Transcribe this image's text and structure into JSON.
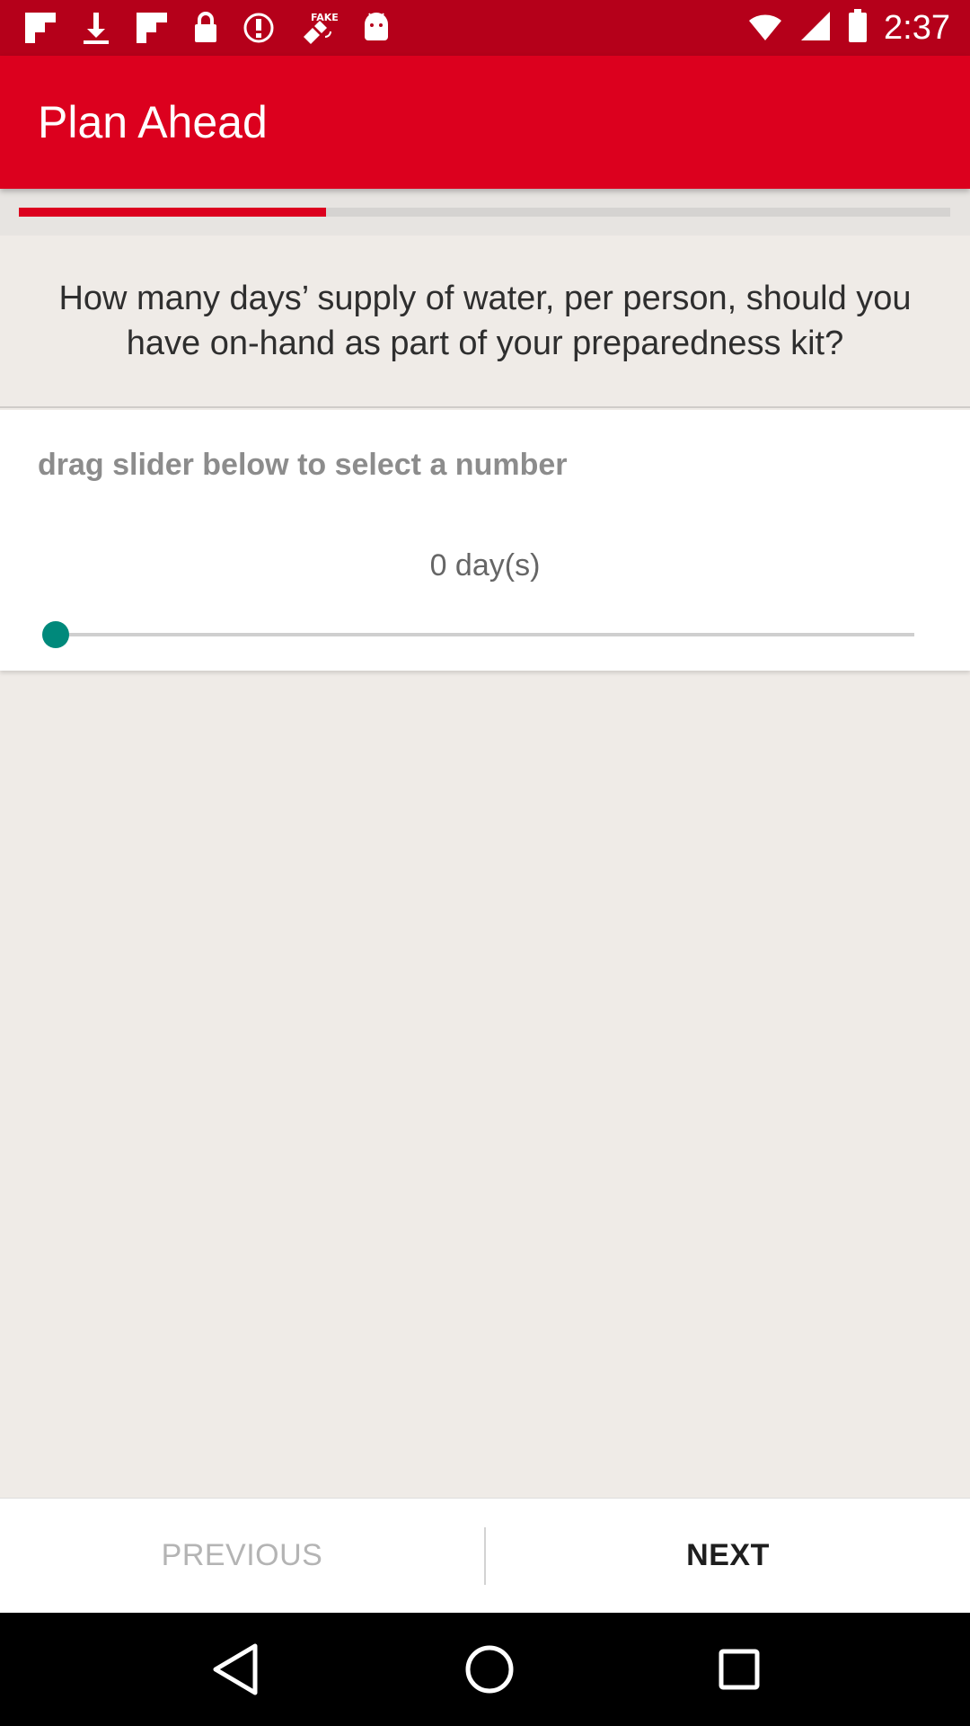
{
  "status_bar": {
    "time": "2:37",
    "icons": [
      "flipboard-icon",
      "download-icon",
      "flipboard-icon",
      "lock-icon",
      "alert-icon",
      "fake-gps-icon",
      "android-icon"
    ],
    "right_icons": [
      "wifi-icon",
      "signal-icon",
      "battery-icon"
    ]
  },
  "app_bar": {
    "title": "Plan Ahead"
  },
  "progress": {
    "fraction": 0.33,
    "color": "#dc001e"
  },
  "question": {
    "text": "How many days’ supply of water, per person, should you have on-hand as part of your preparedness kit?"
  },
  "answer": {
    "hint": "drag slider below to select a number",
    "value_label": "0 day(s)",
    "slider_value": 0,
    "thumb_color": "#00897b"
  },
  "footer": {
    "previous_label": "PREVIOUS",
    "next_label": "NEXT"
  },
  "system_nav": {
    "icons": [
      "back-icon",
      "home-icon",
      "recents-icon"
    ]
  },
  "colors": {
    "brand_red": "#dc001e",
    "status_red": "#b5001a",
    "background": "#efebe7"
  }
}
